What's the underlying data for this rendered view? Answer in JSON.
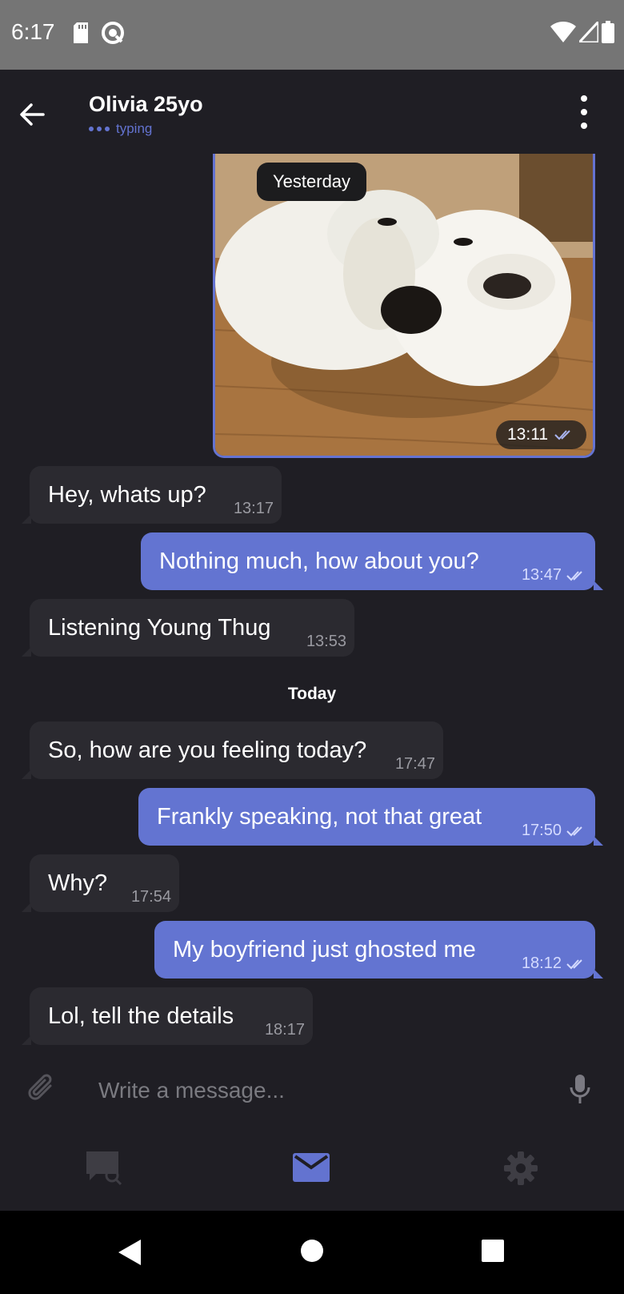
{
  "status_bar": {
    "time": "6:17"
  },
  "header": {
    "contact_name": "Olivia 25yo",
    "status": "typing"
  },
  "chat": {
    "photo_time": "13:11",
    "date_separators": {
      "yesterday": "Yesterday",
      "today": "Today"
    },
    "messages": [
      {
        "text": "Hey, whats up?",
        "time": "13:17",
        "direction": "in"
      },
      {
        "text": "Nothing much, how about you?",
        "time": "13:47",
        "direction": "out"
      },
      {
        "text": "Listening Young Thug",
        "time": "13:53",
        "direction": "in"
      },
      {
        "text": "So, how are you feeling today?",
        "time": "17:47",
        "direction": "in"
      },
      {
        "text": "Frankly speaking, not that great",
        "time": "17:50",
        "direction": "out"
      },
      {
        "text": "Why?",
        "time": "17:54",
        "direction": "in"
      },
      {
        "text": "My boyfriend just ghosted me",
        "time": "18:12",
        "direction": "out"
      },
      {
        "text": "Lol, tell the details",
        "time": "18:17",
        "direction": "in"
      }
    ]
  },
  "composer": {
    "placeholder": "Write a message..."
  },
  "colors": {
    "background": "#1f1e24",
    "incoming": "#2b2a30",
    "outgoing": "#6374d1",
    "accent": "#6373d0"
  }
}
